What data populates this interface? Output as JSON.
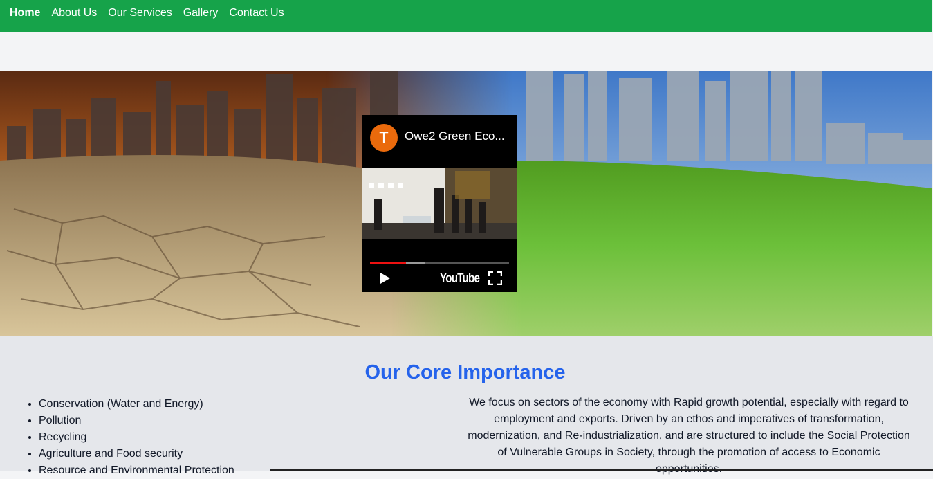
{
  "nav": {
    "items": [
      {
        "label": "Home",
        "active": true
      },
      {
        "label": "About Us"
      },
      {
        "label": "Our Services"
      },
      {
        "label": "Gallery"
      },
      {
        "label": "Contact Us"
      }
    ]
  },
  "hero": {
    "image": "drought-vs-green-city-banner",
    "video": {
      "channel_initial": "T",
      "title": "Owe2 Green Eco...",
      "logo_text": "YouTube",
      "progress": 0.26,
      "buffered": 0.4,
      "play_icon": "play-icon",
      "fullscreen_icon": "fullscreen-icon"
    }
  },
  "core": {
    "heading": "Our Core Importance",
    "list": [
      "Conservation (Water and Energy)",
      "Pollution",
      "Recycling",
      "Agriculture and Food security",
      "Resource and Environmental Protection"
    ],
    "paragraph": "We focus on sectors of the economy with Rapid growth potential, especially with regard to employment and exports. Driven by an ethos and imperatives of transformation, modernization, and Re-industrialization, and are structured to include the Social Protection of Vulnerable Groups in Society, through the promotion of access to Economic opportunities."
  },
  "colors": {
    "nav_bg": "#16a34a",
    "heading": "#2563eb",
    "avatar": "#ea6a0c",
    "progress": "#e11111"
  }
}
